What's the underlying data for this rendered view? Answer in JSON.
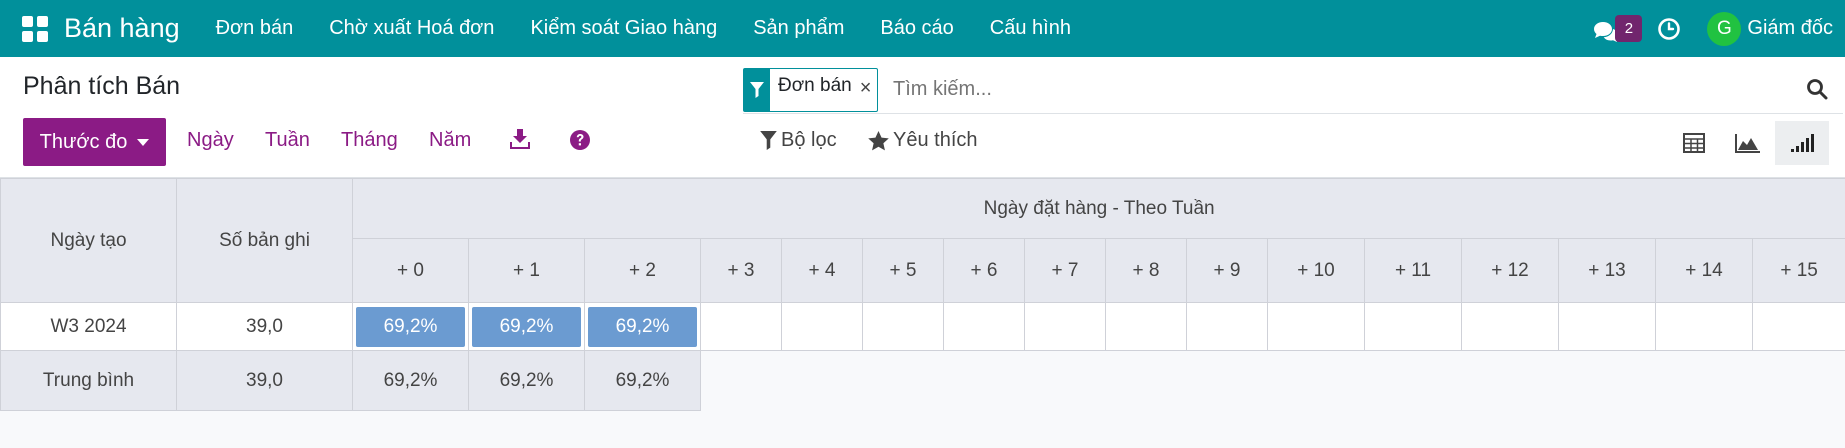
{
  "navbar": {
    "app_name": "Bán hàng",
    "menu": [
      "Đơn bán",
      "Chờ xuất Hoá đơn",
      "Kiểm soát Giao hàng",
      "Sản phẩm",
      "Báo cáo",
      "Cấu hình"
    ],
    "message_count": "2",
    "user_initial": "G",
    "user_name": "Giám đốc",
    "color": "#01909b"
  },
  "control_panel": {
    "title": "Phân tích Bán",
    "measures_label": "Thước đo",
    "intervals": [
      "Ngày",
      "Tuần",
      "Tháng",
      "Năm"
    ],
    "search": {
      "facet_label": "Đơn bán",
      "placeholder": "Tìm kiếm..."
    },
    "filters_label": "Bộ lọc",
    "favorites_label": "Yêu thích",
    "accent": "#8b1b85"
  },
  "pivot": {
    "col_header_date": "Ngày tạo",
    "col_header_count": "Số bản ghi",
    "col_group_header": "Ngày đặt hàng - Theo Tuần",
    "columns": [
      "+ 0",
      "+ 1",
      "+ 2",
      "+ 3",
      "+ 4",
      "+ 5",
      "+ 6",
      "+ 7",
      "+ 8",
      "+ 9",
      "+ 10",
      "+ 11",
      "+ 12",
      "+ 13",
      "+ 14",
      "+ 15"
    ],
    "rows": [
      {
        "label": "W3 2024",
        "count": "39,0",
        "values": [
          "69,2%",
          "69,2%",
          "69,2%"
        ]
      }
    ],
    "total": {
      "label": "Trung bình",
      "count": "39,0",
      "values": [
        "69,2%",
        "69,2%",
        "69,2%"
      ]
    },
    "fill_color": "#6b9bd1"
  }
}
